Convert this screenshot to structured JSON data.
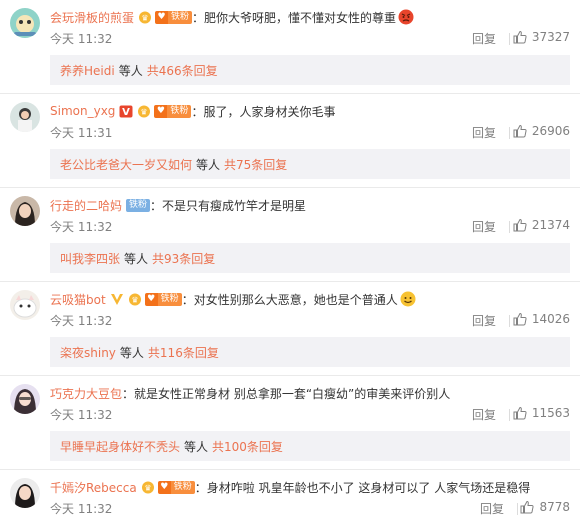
{
  "colors": {
    "link": "#eb7350",
    "meta": "#808080",
    "subbox": "#f2f2f5"
  },
  "comments": [
    {
      "user": "会玩滑板的煎蛋",
      "badge_fan": "铁粉",
      "badges": [
        "vip-icon",
        "fan-badge"
      ],
      "text": "：肥你大爷呀肥，懂不懂对女性的尊重",
      "emoji": "angry-face",
      "time": "今天 11:32",
      "reply_label": "回复",
      "likes": "37327",
      "sub_who": "养养Heidi",
      "sub_mid": "等人",
      "sub_count": "共466条回复"
    },
    {
      "user": "Simon_yxg",
      "badge_fan": "铁粉",
      "badges": [
        "v-icon",
        "vip-icon",
        "fan-badge"
      ],
      "text": "：服了，人家身材关你毛事",
      "emoji": "",
      "time": "今天 11:31",
      "reply_label": "回复",
      "likes": "26906",
      "sub_who": "老公比老爸大一岁又如何",
      "sub_mid": "等人",
      "sub_count": "共75条回复"
    },
    {
      "user": "行走的二哈妈",
      "badge_fan": "铁粉",
      "badges": [
        "gray-fan-badge"
      ],
      "text": "：不是只有瘦成竹竿才是明星",
      "emoji": "",
      "time": "今天 11:32",
      "reply_label": "回复",
      "likes": "21374",
      "sub_who": "叫我李四张",
      "sub_mid": "等人",
      "sub_count": "共93条回复"
    },
    {
      "user": "云吸猫bot",
      "badge_fan": "铁粉",
      "badges": [
        "v-icon",
        "vip-icon",
        "fan-badge"
      ],
      "text": "：对女性别那么大恶意，她也是个普通人",
      "emoji": "smile-face",
      "time": "今天 11:32",
      "reply_label": "回复",
      "likes": "14026",
      "sub_who": "栥夜shiny",
      "sub_mid": "等人",
      "sub_count": "共116条回复"
    },
    {
      "user": "巧克力大豆包",
      "badge_fan": "",
      "badges": [],
      "text": "：就是女性正常身材 别总拿那一套“白瘦幼”的审美来评价别人",
      "emoji": "",
      "time": "今天 11:32",
      "reply_label": "回复",
      "likes": "11563",
      "sub_who": "早睡早起身体好不秃头",
      "sub_mid": "等人",
      "sub_count": "共100条回复"
    },
    {
      "user": "千嫣汐Rebecca",
      "badge_fan": "铁粉",
      "badges": [
        "vip-icon",
        "fan-badge"
      ],
      "text": "：身材咋啦 巩皇年龄也不小了 这身材可以了 人家气场还是稳得",
      "emoji": "",
      "time": "今天 11:32",
      "reply_label": "回复",
      "likes": "8778",
      "sub_who": "",
      "sub_mid": "",
      "sub_count": ""
    }
  ]
}
